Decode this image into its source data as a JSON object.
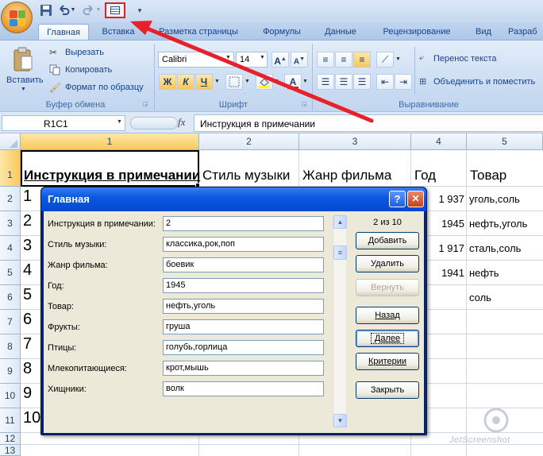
{
  "quick_access": {
    "save_icon": "save-icon",
    "undo_icon": "undo-icon",
    "redo_icon": "redo-icon",
    "form_icon": "form-icon",
    "customize_icon": "customize-qat-icon"
  },
  "tabs": [
    "Главная",
    "Вставка",
    "Разметка страницы",
    "Формулы",
    "Данные",
    "Рецензирование",
    "Вид",
    "Разраб"
  ],
  "ribbon": {
    "clipboard": {
      "paste": "Вставить",
      "cut": "Вырезать",
      "copy": "Копировать",
      "format_painter": "Формат по образцу",
      "label": "Буфер обмена"
    },
    "font": {
      "font_name": "Calibri",
      "font_size": "14",
      "bold": "Ж",
      "italic": "К",
      "underline": "Ч",
      "grow": "A",
      "shrink": "A",
      "font_color": "A",
      "label": "Шрифт"
    },
    "alignment": {
      "wrap": "Перенос текста",
      "merge": "Объединить и поместить",
      "label": "Выравнивание"
    }
  },
  "formula_bar": {
    "name_box": "R1C1",
    "fx": "fx",
    "content": "Инструкция в примечании"
  },
  "grid": {
    "columns": [
      "1",
      "2",
      "3",
      "4",
      "5"
    ],
    "rows": [
      "1",
      "2",
      "3",
      "4",
      "5",
      "6",
      "7",
      "8",
      "9",
      "10",
      "11",
      "12",
      "13"
    ],
    "headers": [
      "Инструкция в примечании",
      "Стиль музыки",
      "Жанр фильма",
      "Год",
      "Товар"
    ],
    "col1": [
      "1",
      "2",
      "3",
      "4",
      "5",
      "6",
      "7",
      "8",
      "9",
      "10"
    ],
    "col4": [
      "1 937",
      "1945",
      "1 917",
      "1941"
    ],
    "col5": [
      "уголь,соль",
      "нефть,уголь",
      "сталь,соль",
      "нефть",
      "соль"
    ]
  },
  "dialog": {
    "title": "Главная",
    "counter": "2 из 10",
    "fields": [
      {
        "label": "Инструкция в примечании:",
        "value": "2"
      },
      {
        "label": "Стиль музыки:",
        "value": "классика,рок,поп"
      },
      {
        "label": "Жанр фильма:",
        "value": "боевик"
      },
      {
        "label": "Год:",
        "value": "1945"
      },
      {
        "label": "Товар:",
        "value": "нефть,уголь"
      },
      {
        "label": "Фрукты:",
        "value": "груша"
      },
      {
        "label": "Птицы:",
        "value": "голубь,горлица"
      },
      {
        "label": "Млекопитающиеся:",
        "value": "крот,мышь"
      },
      {
        "label": "Хищники:",
        "value": "волк"
      }
    ],
    "buttons": {
      "add": "Добавить",
      "delete": "Удалить",
      "restore": "Вернуть",
      "back": "Назад",
      "next": "Далее",
      "criteria": "Критерии",
      "close": "Закрыть"
    },
    "help": "?",
    "close_x": "✕"
  },
  "watermark": "JetScreenshot",
  "colors": {
    "arrow": "#e8202a",
    "title_bar": "#0a5ae0",
    "selected_header": "#f9c85e"
  }
}
